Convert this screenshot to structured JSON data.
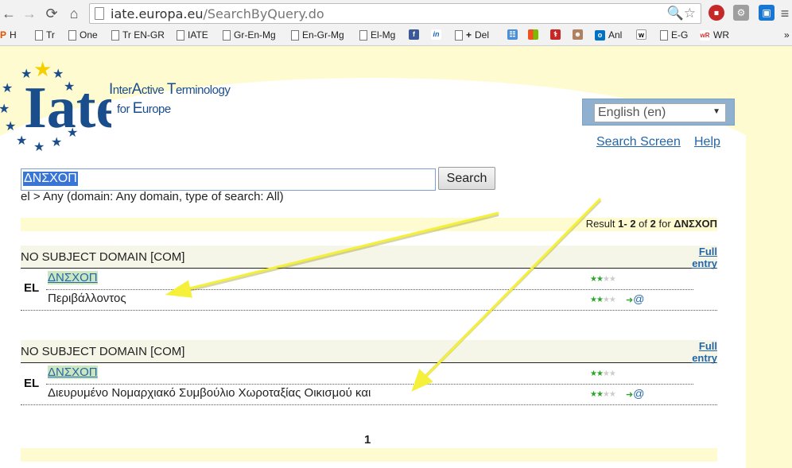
{
  "browser": {
    "url_host": "iate.europa.eu",
    "url_path": "/SearchByQuery.do",
    "bookmarks": [
      "H",
      "Tr",
      "One",
      "Tr EN-GR",
      "IATE",
      "Gr-En-Mg",
      "En-Gr-Mg",
      "El-Mg",
      "Del",
      "Anl",
      "E-G",
      "WR"
    ],
    "bookmark_first": "P"
  },
  "header": {
    "logo_text": "Iate",
    "tagline_line1_parts": [
      "I",
      "nter",
      "A",
      "ctive ",
      "T",
      "erminology"
    ],
    "tagline_line2_parts": [
      "for ",
      "E",
      "urope"
    ],
    "language_selected": "English (en)",
    "links": {
      "search_screen": "Search Screen ",
      "help": "Help"
    }
  },
  "search": {
    "query": "ΔΝΣΧΟΠ",
    "button_label": "Search",
    "criteria": "el > Any (domain: Any domain, type of search: All)"
  },
  "results": {
    "summary_prefix": "Result ",
    "summary_range": "1- 2",
    "summary_of": " of ",
    "summary_total": "2",
    "summary_for": " for ",
    "summary_query": "ΔΝΣΧΟΠ",
    "entries": [
      {
        "domain": "NO SUBJECT DOMAIN [COM]",
        "full_entry_1": "Full",
        "full_entry_2": "entry",
        "lang": "EL",
        "term1": "ΔΝΣΧΟΠ",
        "term2": "Περιβάλλοντος",
        "reliability": 2
      },
      {
        "domain": "NO SUBJECT DOMAIN [COM]",
        "full_entry_1": "Full",
        "full_entry_2": "entry",
        "lang": "EL",
        "term1": "ΔΝΣΧΟΠ",
        "term2": "Διευρυμένο Νομαρχιακό Συμβούλιο Χωροταξίας Οικισμού και",
        "reliability": 2
      }
    ],
    "page": "1"
  },
  "colors": {
    "accent": "#2467a8",
    "band": "#fffbd0",
    "arrow": "#f5f03a"
  }
}
